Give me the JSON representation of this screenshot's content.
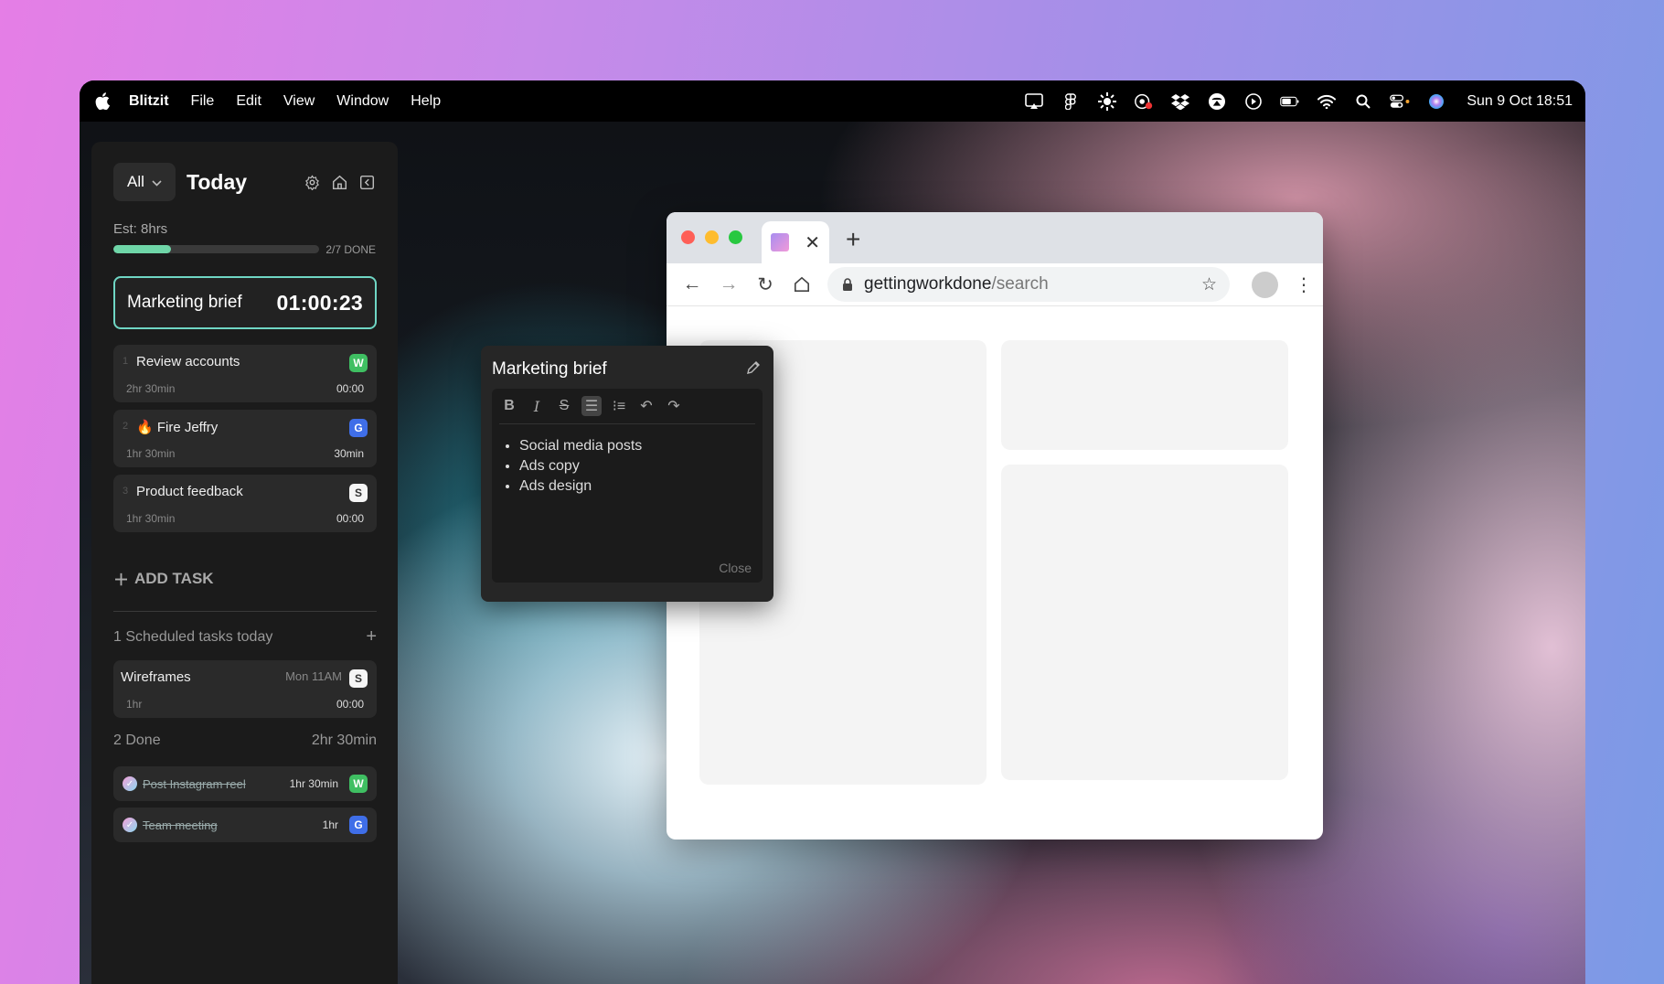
{
  "menubar": {
    "app": "Blitzit",
    "items": [
      "File",
      "Edit",
      "View",
      "Window",
      "Help"
    ],
    "clock": "Sun 9 Oct  18:51"
  },
  "sidebar": {
    "filter": "All",
    "title": "Today",
    "estimate": "Est: 8hrs",
    "progress_text": "2/7 DONE",
    "progress": 0.28,
    "current_task": {
      "name": "Marketing brief",
      "timer": "01:00:23"
    },
    "tasks": [
      {
        "num": "1",
        "name": "Review accounts",
        "est": "2hr 30min",
        "value": "00:00",
        "badge": "W"
      },
      {
        "num": "2",
        "name": "🔥 Fire Jeffry",
        "est": "1hr 30min",
        "value": "30min",
        "badge": "G"
      },
      {
        "num": "3",
        "name": "Product feedback",
        "est": "1hr 30min",
        "value": "00:00",
        "badge": "S"
      }
    ],
    "add_task": "ADD TASK",
    "scheduled_header": "1 Scheduled tasks today",
    "scheduled": {
      "name": "Wireframes",
      "when": "Mon 11AM",
      "est": "1hr",
      "value": "00:00"
    },
    "done_header": "2 Done",
    "done_total": "2hr 30min",
    "done": [
      {
        "name": "Post Instagram reel",
        "time": "1hr 30min",
        "badge": "W"
      },
      {
        "name": "Team meeting",
        "time": "1hr",
        "badge": "G"
      }
    ]
  },
  "browser": {
    "url_host": "gettingworkdone",
    "url_path": "/search"
  },
  "note": {
    "title": "Marketing brief",
    "items": [
      "Social media posts",
      "Ads copy",
      "Ads design"
    ],
    "close": "Close"
  }
}
